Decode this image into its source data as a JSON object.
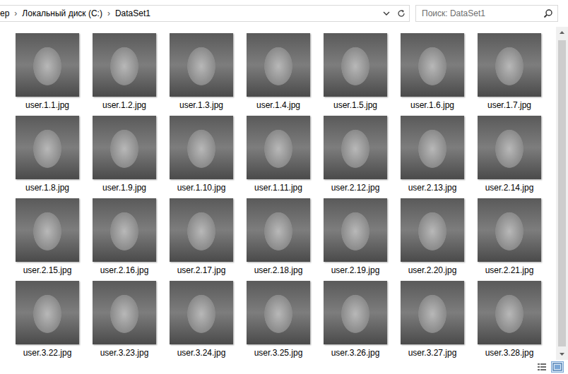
{
  "window": {
    "title": "DataSet1"
  },
  "address_bar": {
    "path": [
      "ер",
      "Локальный диск (C:)",
      "DataSet1"
    ],
    "separator": "›"
  },
  "search": {
    "placeholder": "Поиск: DataSet1"
  },
  "files": [
    {
      "name": "user.1.1.jpg"
    },
    {
      "name": "user.1.2.jpg"
    },
    {
      "name": "user.1.3.jpg"
    },
    {
      "name": "user.1.4.jpg"
    },
    {
      "name": "user.1.5.jpg"
    },
    {
      "name": "user.1.6.jpg"
    },
    {
      "name": "user.1.7.jpg"
    },
    {
      "name": "user.1.8.jpg"
    },
    {
      "name": "user.1.9.jpg"
    },
    {
      "name": "user.1.10.jpg"
    },
    {
      "name": "user.1.11.jpg"
    },
    {
      "name": "user.2.12.jpg"
    },
    {
      "name": "user.2.13.jpg"
    },
    {
      "name": "user.2.14.jpg"
    },
    {
      "name": "user.2.15.jpg"
    },
    {
      "name": "user.2.16.jpg"
    },
    {
      "name": "user.2.17.jpg"
    },
    {
      "name": "user.2.18.jpg"
    },
    {
      "name": "user.2.19.jpg"
    },
    {
      "name": "user.2.20.jpg"
    },
    {
      "name": "user.2.21.jpg"
    },
    {
      "name": "user.3.22.jpg"
    },
    {
      "name": "user.3.23.jpg"
    },
    {
      "name": "user.3.24.jpg"
    },
    {
      "name": "user.3.25.jpg"
    },
    {
      "name": "user.3.26.jpg"
    },
    {
      "name": "user.3.27.jpg"
    },
    {
      "name": "user.3.28.jpg"
    }
  ],
  "status_bar": {
    "views": [
      {
        "kind": "details",
        "selected": false
      },
      {
        "kind": "thumbnails",
        "selected": true
      }
    ]
  }
}
